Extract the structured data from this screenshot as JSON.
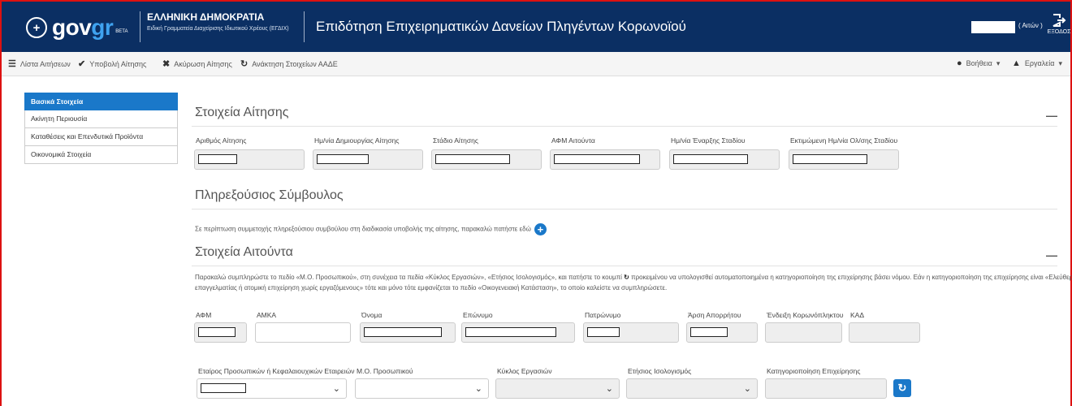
{
  "header": {
    "logo_text_gov": "gov",
    "logo_text_gr": "gr",
    "logo_badge": "BETA",
    "ministry_title": "ΕΛΛΗΝΙΚΗ ΔΗΜΟΚΡΑΤΙΑ",
    "ministry_subtitle": "Ειδική Γραμματεία Διαχείρισης Ιδιωτικού Χρέους (ΕΓΔΙΧ)",
    "app_title": "Επιδότηση Επιχειρηματικών Δανείων Πληγέντων Κορωνοϊού",
    "user_role": "( Αιτών )",
    "logout_label": "ΕΞΟΔΟΣ"
  },
  "toolbar": {
    "list_label": "Λίστα Αιτήσεων",
    "submit_label": "Υποβολή Αίτησης",
    "cancel_label": "Ακύρωση Αίτησης",
    "fetch_label": "Ανάκτηση Στοιχείων ΑΑΔΕ",
    "help_label": "Βοήθεια",
    "tools_label": "Εργαλεία"
  },
  "sidebar": {
    "items": [
      {
        "label": "Βασικά Στοιχεία",
        "active": true
      },
      {
        "label": "Ακίνητη Περιουσία",
        "active": false
      },
      {
        "label": "Καταθέσεις και Επενδυτικά Προϊόντα",
        "active": false
      },
      {
        "label": "Οικονομικά Στοιχεία",
        "active": false
      }
    ]
  },
  "application": {
    "title": "Στοιχεία Αίτησης",
    "fields": [
      {
        "label": "Αριθμός Αίτησης"
      },
      {
        "label": "Ημ/νία Δημιουργίας Αίτησης"
      },
      {
        "label": "Στάδιο Αίτησης"
      },
      {
        "label": "ΑΦΜ Αιτούντα"
      },
      {
        "label": "Ημ/νία Έναρξης Σταδίου"
      },
      {
        "label": "Εκτιμώμενη Ημ/νία Ολ/σης Σταδίου"
      }
    ]
  },
  "advisor": {
    "title": "Πληρεξούσιος Σύμβουλος",
    "text": "Σε περίπτωση συμμετοχής πληρεξούσιου συμβούλου στη διαδικασία υποβολής της αίτησης, παρακαλώ πατήστε εδώ"
  },
  "applicant": {
    "title": "Στοιχεία Αιτούντα",
    "help_part1": "Παρακαλώ συμπληρώστε το πεδίο «Μ.Ο. Προσωπικού», στη συνέχεια τα πεδία «Κύκλος Εργασιών», «Ετήσιος Ισολογισμός», και πατήστε το κουμπί",
    "help_part2": "προκειμένου να υπολογισθεί αυτοματοποιημένα η κατηγοριοποίηση της επιχείρησης βάσει νόμου. Εάν η κατηγοριοποίηση της επιχείρησης είναι «Ελεύθερος",
    "help_line2": "επαγγελματίας ή ατομική επιχείρηση χωρίς εργαζόμενους» τότε και μόνο τότε εμφανίζεται το πεδίο «Οικογενειακή Κατάσταση», το οποίο καλείστε να συμπληρώσετε.",
    "row1": [
      {
        "label": "ΑΦΜ"
      },
      {
        "label": "ΑΜΚΑ"
      },
      {
        "label": "Όνομα"
      },
      {
        "label": "Επώνυμο"
      },
      {
        "label": "Πατρώνυμο"
      },
      {
        "label": "Άρση Απορρήτου"
      },
      {
        "label": "Ένδειξη Κορωνόπληκτου"
      },
      {
        "label": "ΚΑΔ"
      }
    ],
    "row2": [
      {
        "label": "Εταίρος Προσωπικών ή Κεφαλαιουχικών Εταιρειών"
      },
      {
        "label": "Μ.Ο. Προσωπικού"
      },
      {
        "label": "Κύκλος Εργασιών"
      },
      {
        "label": "Ετήσιος Ισολογισμός"
      },
      {
        "label": "Κατηγοριοποίηση Επιχείρησης"
      }
    ]
  },
  "colors": {
    "header_bg": "#0b2f63",
    "accent": "#1a78c9",
    "frame": "#dd1111"
  }
}
